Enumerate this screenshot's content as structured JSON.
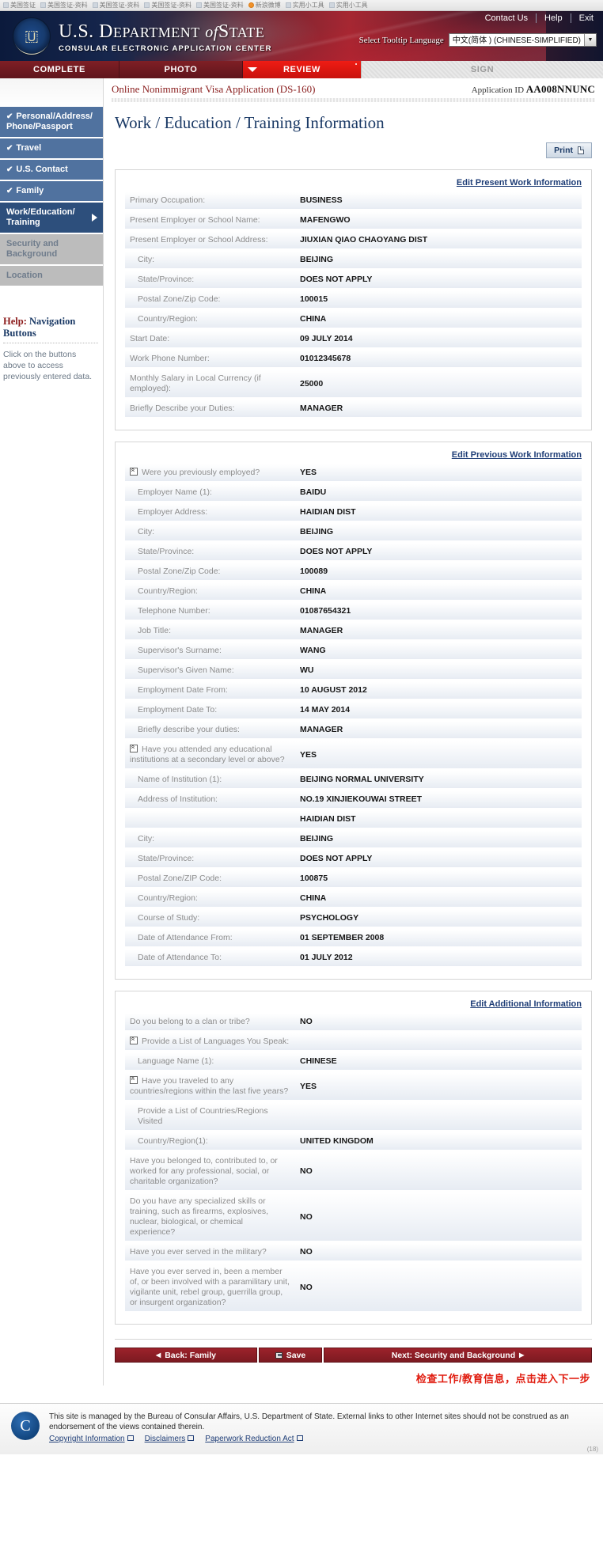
{
  "browser": {
    "bookmarks": [
      "美国签证",
      "美国签证-资料",
      "美国签证-资料",
      "美国签证-资料",
      "美国签证-资料",
      "新浪微博",
      "实用小工具",
      "实用小工具"
    ]
  },
  "banner": {
    "links": [
      "Contact Us",
      "Help",
      "Exit"
    ],
    "dept_line1_a": "U.S. D",
    "dept_line1_b": "EPARTMENT",
    "dept_line1_c": "of",
    "dept_line1_d": "S",
    "dept_line1_e": "TATE",
    "dept_line2": "CONSULAR ELECTRONIC APPLICATION CENTER",
    "lang_label": "Select Tooltip Language",
    "lang_value": "中文(简体 ) (CHINESE-SIMPLIFIED)"
  },
  "tabs": [
    {
      "label": "COMPLETE",
      "state": "complete"
    },
    {
      "label": "PHOTO",
      "state": "complete"
    },
    {
      "label": "REVIEW",
      "state": "active"
    },
    {
      "label": "SIGN",
      "state": "disabled"
    }
  ],
  "sidebar": {
    "items": [
      {
        "label": "Personal/Address/ Phone/Passport",
        "state": "done"
      },
      {
        "label": "Travel",
        "state": "done"
      },
      {
        "label": "U.S. Contact",
        "state": "done"
      },
      {
        "label": "Family",
        "state": "done"
      },
      {
        "label": "Work/Education/ Training",
        "state": "current"
      },
      {
        "label": "Security and Background",
        "state": "locked"
      },
      {
        "label": "Location",
        "state": "locked"
      }
    ],
    "help_title_red": "Help:",
    "help_title_rest": "Navigation Buttons",
    "help_text": "Click on the buttons above to access previously entered data."
  },
  "appbar": {
    "app_title": "Online Nonimmigrant Visa Application (DS-160)",
    "app_id_label": "Application ID",
    "app_id_value": "AA008NNUNC"
  },
  "page_title": "Work / Education / Training Information",
  "print_label": "Print",
  "panels": [
    {
      "edit_link": "Edit Present Work Information",
      "rows": [
        {
          "key": "Primary Occupation:",
          "value": "BUSINESS",
          "indent": false,
          "tip": false
        },
        {
          "key": "Present Employer or School Name:",
          "value": "MAFENGWO",
          "indent": false,
          "tip": false
        },
        {
          "key": "Present Employer or School Address:",
          "value": "JIUXIAN QIAO CHAOYANG DIST",
          "indent": false,
          "tip": false
        },
        {
          "key": "City:",
          "value": "BEIJING",
          "indent": true,
          "tip": false
        },
        {
          "key": "State/Province:",
          "value": "DOES NOT APPLY",
          "indent": true,
          "tip": false
        },
        {
          "key": "Postal Zone/Zip Code:",
          "value": "100015",
          "indent": true,
          "tip": false
        },
        {
          "key": "Country/Region:",
          "value": "CHINA",
          "indent": true,
          "tip": false
        },
        {
          "key": "Start Date:",
          "value": "09 JULY 2014",
          "indent": false,
          "tip": false
        },
        {
          "key": "Work Phone Number:",
          "value": "01012345678",
          "indent": false,
          "tip": false
        },
        {
          "key": "Monthly Salary in Local Currency (if employed):",
          "value": "25000",
          "indent": false,
          "tip": false
        },
        {
          "key": "Briefly Describe your Duties:",
          "value": "MANAGER",
          "indent": false,
          "tip": false
        }
      ]
    },
    {
      "edit_link": "Edit Previous Work Information",
      "rows": [
        {
          "key": "Were you previously employed?",
          "value": "YES",
          "indent": false,
          "tip": true
        },
        {
          "key": "Employer Name (1):",
          "value": "BAIDU",
          "indent": true,
          "tip": false
        },
        {
          "key": "Employer Address:",
          "value": "HAIDIAN DIST",
          "indent": true,
          "tip": false
        },
        {
          "key": "City:",
          "value": "BEIJING",
          "indent": true,
          "tip": false
        },
        {
          "key": "State/Province:",
          "value": "DOES NOT APPLY",
          "indent": true,
          "tip": false
        },
        {
          "key": "Postal Zone/Zip Code:",
          "value": "100089",
          "indent": true,
          "tip": false
        },
        {
          "key": "Country/Region:",
          "value": "CHINA",
          "indent": true,
          "tip": false
        },
        {
          "key": "Telephone Number:",
          "value": "01087654321",
          "indent": true,
          "tip": false
        },
        {
          "key": "Job Title:",
          "value": "MANAGER",
          "indent": true,
          "tip": false
        },
        {
          "key": "Supervisor's Surname:",
          "value": "WANG",
          "indent": true,
          "tip": false
        },
        {
          "key": "Supervisor's Given Name:",
          "value": "WU",
          "indent": true,
          "tip": false
        },
        {
          "key": "Employment Date From:",
          "value": "10 AUGUST 2012",
          "indent": true,
          "tip": false
        },
        {
          "key": "Employment Date To:",
          "value": "14 MAY 2014",
          "indent": true,
          "tip": false
        },
        {
          "key": "Briefly describe your duties:",
          "value": "MANAGER",
          "indent": true,
          "tip": false
        },
        {
          "key": "Have you attended any educational institutions at a secondary level or above?",
          "value": "YES",
          "indent": false,
          "tip": true
        },
        {
          "key": "Name of Institution (1):",
          "value": "BEIJING NORMAL UNIVERSITY",
          "indent": true,
          "tip": false
        },
        {
          "key": "Address of Institution:",
          "value": "NO.19 XINJIEKOUWAI STREET",
          "indent": true,
          "tip": false
        },
        {
          "key": "",
          "value": "HAIDIAN DIST",
          "indent": true,
          "tip": false
        },
        {
          "key": "City:",
          "value": "BEIJING",
          "indent": true,
          "tip": false
        },
        {
          "key": "State/Province:",
          "value": "DOES NOT APPLY",
          "indent": true,
          "tip": false
        },
        {
          "key": "Postal Zone/ZIP Code:",
          "value": "100875",
          "indent": true,
          "tip": false
        },
        {
          "key": "Country/Region:",
          "value": "CHINA",
          "indent": true,
          "tip": false
        },
        {
          "key": "Course of Study:",
          "value": "PSYCHOLOGY",
          "indent": true,
          "tip": false
        },
        {
          "key": "Date of Attendance From:",
          "value": "01 SEPTEMBER 2008",
          "indent": true,
          "tip": false
        },
        {
          "key": "Date of Attendance To:",
          "value": "01 JULY 2012",
          "indent": true,
          "tip": false
        }
      ]
    },
    {
      "edit_link": "Edit Additional Information",
      "rows": [
        {
          "key": "Do you belong to a clan or tribe?",
          "value": "NO",
          "indent": false,
          "tip": false
        },
        {
          "key": "Provide a List of Languages You Speak:",
          "value": "",
          "indent": false,
          "tip": true
        },
        {
          "key": "Language Name (1):",
          "value": "CHINESE",
          "indent": true,
          "tip": false
        },
        {
          "key": "Have you traveled to any countries/regions within the last five years?",
          "value": "YES",
          "indent": false,
          "tip": true
        },
        {
          "key": "Provide a List of Countries/Regions Visited",
          "value": "",
          "indent": true,
          "tip": false
        },
        {
          "key": "Country/Region(1):",
          "value": "UNITED KINGDOM",
          "indent": true,
          "tip": false
        },
        {
          "key": "Have you belonged to, contributed to, or worked for any professional, social, or charitable organization?",
          "value": "NO",
          "indent": false,
          "tip": false
        },
        {
          "key": "Do you have any specialized skills or training, such as firearms, explosives, nuclear, biological, or chemical experience?",
          "value": "NO",
          "indent": false,
          "tip": false
        },
        {
          "key": "Have you ever served in the military?",
          "value": "NO",
          "indent": false,
          "tip": false
        },
        {
          "key": "Have you ever served in, been a member of, or been involved with a paramilitary unit, vigilante unit, rebel group, guerrilla group, or insurgent organization?",
          "value": "NO",
          "indent": false,
          "tip": false
        }
      ]
    }
  ],
  "footer_nav": {
    "back_label": "Back: Family",
    "save_label": "Save",
    "next_label": "Next: Security and Background"
  },
  "annotation": "检查工作/教育信息，点击进入下一步",
  "site_footer": {
    "text": "This site is managed by the Bureau of Consular Affairs, U.S. Department of State. External links to other Internet sites should not be construed as an endorsement of the views contained therein.",
    "links": [
      "Copyright Information",
      "Disclaimers",
      "Paperwork Reduction Act"
    ],
    "corner": "(18)"
  }
}
